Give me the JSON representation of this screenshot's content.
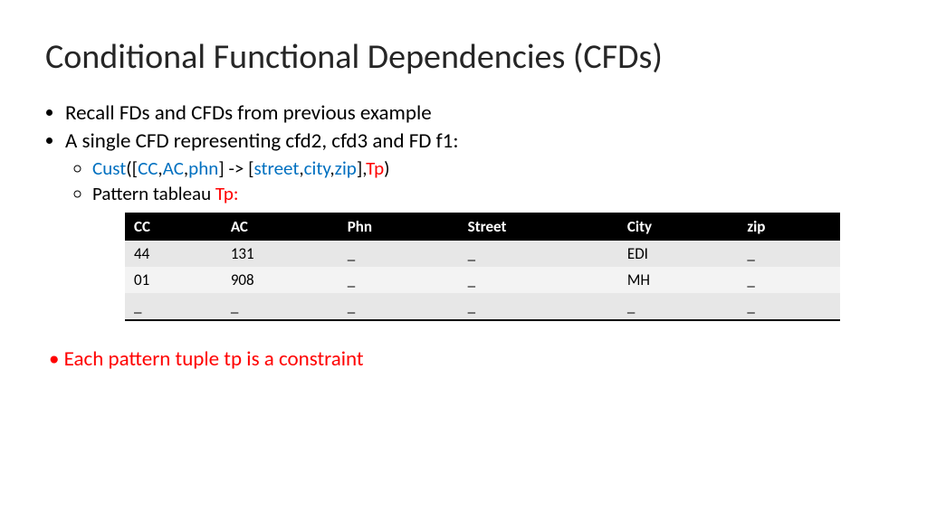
{
  "title": "Conditional Functional Dependencies (CFDs)",
  "bullets": {
    "b1": "Recall FDs and CFDs from previous example",
    "b2": "A single CFD representing cfd2, cfd3 and FD f1:",
    "sub1": {
      "cust": "Cust",
      "open": "([",
      "cc": "CC",
      "c1": ",",
      "ac": "AC",
      "c2": ",",
      "phn": "phn",
      "mid": "] -> [",
      "street": "street",
      "c3": ",",
      "city": "city",
      "c4": ",",
      "zip": "zip",
      "close": "],",
      "tp": "Tp",
      "end": ")"
    },
    "sub2_prefix": "Pattern tableau ",
    "sub2_tp": "Tp:"
  },
  "table": {
    "headers": [
      "CC",
      "AC",
      "Phn",
      "Street",
      "City",
      "zip"
    ],
    "rows": [
      [
        "44",
        "131",
        "_",
        "_",
        "EDI",
        "_"
      ],
      [
        "01",
        "908",
        "_",
        "_",
        "MH",
        "_"
      ],
      [
        "_",
        "_",
        "_",
        "_",
        "_",
        "_"
      ]
    ]
  },
  "constraint": "Each pattern tuple tp is a constraint"
}
